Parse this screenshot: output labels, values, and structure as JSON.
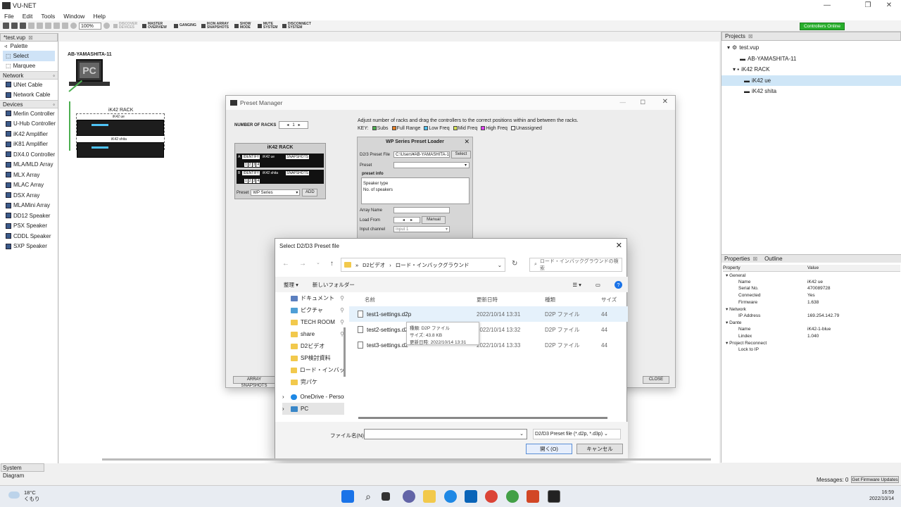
{
  "app": {
    "title": "VU-NET",
    "menu": [
      "File",
      "Edit",
      "Tools",
      "Window",
      "Help"
    ],
    "zoom": "100%",
    "toolbar_buttons": [
      {
        "label": "DISCOVER DEVICES",
        "enabled": false
      },
      {
        "label": "MASTER OVERVIEW",
        "enabled": true
      },
      {
        "label": "GANGING",
        "enabled": true
      },
      {
        "label": "IKON ARRAY SNAPSHOTS",
        "enabled": true
      },
      {
        "label": "SHOW MODE",
        "enabled": true
      },
      {
        "label": "MUTE SYSTEM",
        "enabled": true
      },
      {
        "label": "DISCONNECT SYSTEM",
        "enabled": true
      }
    ],
    "online_badge": "Controllers Online",
    "doc_tab": "*test.vup"
  },
  "palette": {
    "title": "Palette",
    "tools": [
      "Select",
      "Marquee"
    ],
    "network_header": "Network",
    "network_items": [
      "UNet Cable",
      "Network Cable"
    ],
    "devices_header": "Devices",
    "device_items": [
      "Merlin Controller",
      "U-Hub Controller",
      "iK42 Amplifier",
      "iK81 Amplifier",
      "DX4.0 Controller",
      "MLA/MLD Array",
      "MLX Array",
      "MLAC Array",
      "DSX Array",
      "MLAMini Array",
      "DD12 Speaker",
      "PSX Speaker",
      "CDDL Speaker",
      "SXP Speaker"
    ]
  },
  "diagram": {
    "pc_label": "AB-YAMASHITA-11",
    "pc_text": "PC",
    "rack_label": "iK42 RACK",
    "amp1": "iK42 ue",
    "amp2": "iK42 shita"
  },
  "projects": {
    "title": "Projects",
    "items": [
      "test.vup",
      "AB-YAMASHITA-11",
      "iK42 RACK",
      "iK42 ue",
      "iK42 shita"
    ]
  },
  "properties": {
    "tab1": "Properties",
    "tab2": "Outline",
    "col_property": "Property",
    "col_value": "Value",
    "rows": [
      {
        "k": "General",
        "v": "",
        "group": true
      },
      {
        "k": "Name",
        "v": "iK42 ue"
      },
      {
        "k": "Serial No.",
        "v": "470089728"
      },
      {
        "k": "Connected",
        "v": "Yes"
      },
      {
        "k": "Firmware",
        "v": "1.638"
      },
      {
        "k": "Network",
        "v": "",
        "group": true
      },
      {
        "k": "IP Address",
        "v": "169.254.142.79"
      },
      {
        "k": "Dante",
        "v": "",
        "group": true
      },
      {
        "k": "Name",
        "v": "iK42-1-blue"
      },
      {
        "k": "Lindex",
        "v": "1.040"
      },
      {
        "k": "Project Reconnect",
        "v": "",
        "group": true
      },
      {
        "k": "Lock to IP",
        "v": ""
      }
    ]
  },
  "preset_manager": {
    "title": "Preset Manager",
    "racks_label": "NUMBER OF RACKS",
    "racks_value": "1",
    "instruction": "Adjust number of racks and drag the controllers to the correct positions within and between the racks.",
    "key_label": "KEY:",
    "key_items": [
      {
        "label": "Subs",
        "color": "#4caf50"
      },
      {
        "label": "Full Range",
        "color": "#e67e22"
      },
      {
        "label": "Low Freq",
        "color": "#4fc3f7"
      },
      {
        "label": "Mid Freq",
        "color": "#d4e157"
      },
      {
        "label": "High Freq",
        "color": "#e040fb"
      },
      {
        "label": "Unassigned",
        "color": "#ffffff"
      }
    ],
    "rack_title": "iK42 RACK",
    "slotA": {
      "letter": "A",
      "identify": "IDENTIFY",
      "name": "iK42 ue",
      "snapshots": "SNAPSHOTS"
    },
    "slotB": {
      "letter": "B",
      "identify": "IDENTIFY",
      "name": "iK42 shita",
      "snapshots": "SNAPSHOTS"
    },
    "channels": [
      "1",
      "2",
      "3",
      "4"
    ],
    "preset_label": "Preset",
    "preset_value": "WP Series",
    "add_label": "ADD",
    "array_snapshots": "ARRAY SNAPSHOTS",
    "close_label": "CLOSE",
    "loader": {
      "title": "WP Series Preset Loader",
      "file_label": "D2/3 Preset File",
      "file_value": "C:\\Users¥AB-YAMASHITA-1",
      "select": "Select",
      "preset_label": "Preset",
      "info_label": "preset info",
      "info_lines": [
        "Speaker type",
        "No. of speakers"
      ],
      "array_name": "Array Name",
      "load_from": "Load From",
      "manual": "Manual",
      "input_channel": "Input channel",
      "input_value": "Input 1"
    }
  },
  "file_dialog": {
    "title": "Select D2/D3 Preset file",
    "breadcrumb": [
      "D2ビデオ",
      "ロード・インバックグラウンド"
    ],
    "search_placeholder": "ロード・インバックグラウンドの検索",
    "organize": "整理 ▾",
    "new_folder": "新しいフォルダー",
    "cols": {
      "name": "名前",
      "date": "更新日時",
      "type": "種類",
      "size": "サイズ"
    },
    "nav": [
      "ドキュメント",
      "ピクチャ",
      "TECH ROOM",
      "share",
      "D2ビデオ",
      "SP検討資料",
      "ロード・インバック",
      "完パケ",
      "OneDrive - Persor",
      "PC"
    ],
    "files": [
      {
        "name": "test1-settings.d2p",
        "date": "2022/10/14 13:31",
        "type": "D2P ファイル",
        "size": "44"
      },
      {
        "name": "test2-settings.d2",
        "date": "2022/10/14 13:32",
        "type": "D2P ファイル",
        "size": "44"
      },
      {
        "name": "test3-settings.d2",
        "date": "2022/10/14 13:33",
        "type": "D2P ファイル",
        "size": "44"
      }
    ],
    "tooltip": [
      "種類: D2P ファイル",
      "サイズ: 43.8 KB",
      "更新日時: 2022/10/14 13:31"
    ],
    "filename_label": "ファイル名(N):",
    "filter": "D2/D3 Preset file (*.d2p, *.d3p)",
    "open": "開く(O)",
    "cancel": "キャンセル"
  },
  "status": {
    "tab": "System Diagram",
    "messages": "Messages: 0",
    "firmware_btn": "Get Firmware Updates"
  },
  "taskbar": {
    "weather_temp": "18°C",
    "weather_desc": "くもり",
    "time": "16:59",
    "date": "2022/10/14"
  }
}
